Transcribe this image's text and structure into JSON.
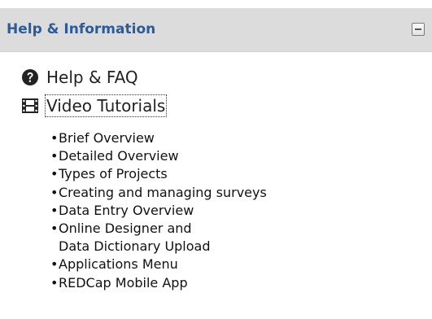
{
  "panel": {
    "title": "Help & Information",
    "accent_color": "#2d5b9a",
    "header_bg": "#dcdcdc",
    "collapse_icon": "minus-box-icon"
  },
  "links": [
    {
      "label": "Help & FAQ",
      "icon": "question-circle-icon"
    },
    {
      "label": "Video Tutorials",
      "icon": "film-icon"
    }
  ],
  "videos": {
    "bullet": "•",
    "items": [
      {
        "label": "Brief Overview"
      },
      {
        "label": "Detailed Overview"
      },
      {
        "label": "Types of Projects"
      },
      {
        "label": "Creating and managing surveys"
      },
      {
        "label": "Data Entry Overview"
      },
      {
        "label": "Online Designer and",
        "continuation": "Data Dictionary Upload"
      },
      {
        "label": "Applications Menu"
      },
      {
        "label": "REDCap Mobile App"
      }
    ]
  }
}
